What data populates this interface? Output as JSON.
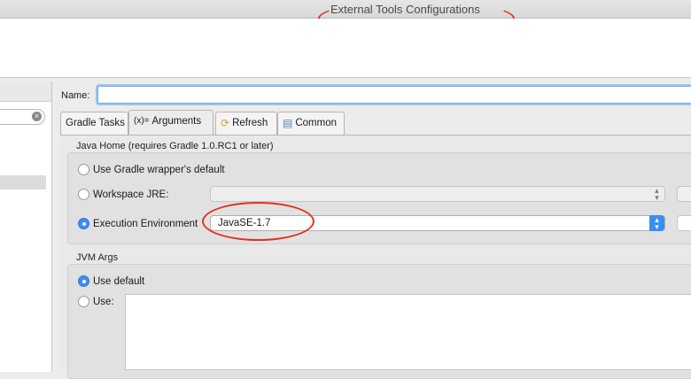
{
  "window": {
    "title": "External Tools Configurations"
  },
  "name_field": {
    "label": "Name:",
    "value": ""
  },
  "tabs": [
    {
      "label": "Gradle Tasks",
      "icon": ""
    },
    {
      "label": "Arguments",
      "icon": "(x)="
    },
    {
      "label": "Refresh",
      "icon": "refresh-icon"
    },
    {
      "label": "Common",
      "icon": "common-icon"
    }
  ],
  "java_home": {
    "title": "Java Home (requires Gradle 1.0.RC1 or later)",
    "options": [
      {
        "label": "Use Gradle wrapper's default",
        "selected": false
      },
      {
        "label": "Workspace JRE:",
        "selected": false,
        "value": ""
      },
      {
        "label": "Execution Environment",
        "selected": true,
        "value": "JavaSE-1.7"
      }
    ]
  },
  "jvm_args": {
    "title": "JVM Args",
    "options": [
      {
        "label": "Use default",
        "selected": true
      },
      {
        "label": "Use:",
        "selected": false,
        "value": ""
      }
    ]
  },
  "colors": {
    "accent": "#3b8df3",
    "annotation": "#e0321e"
  }
}
